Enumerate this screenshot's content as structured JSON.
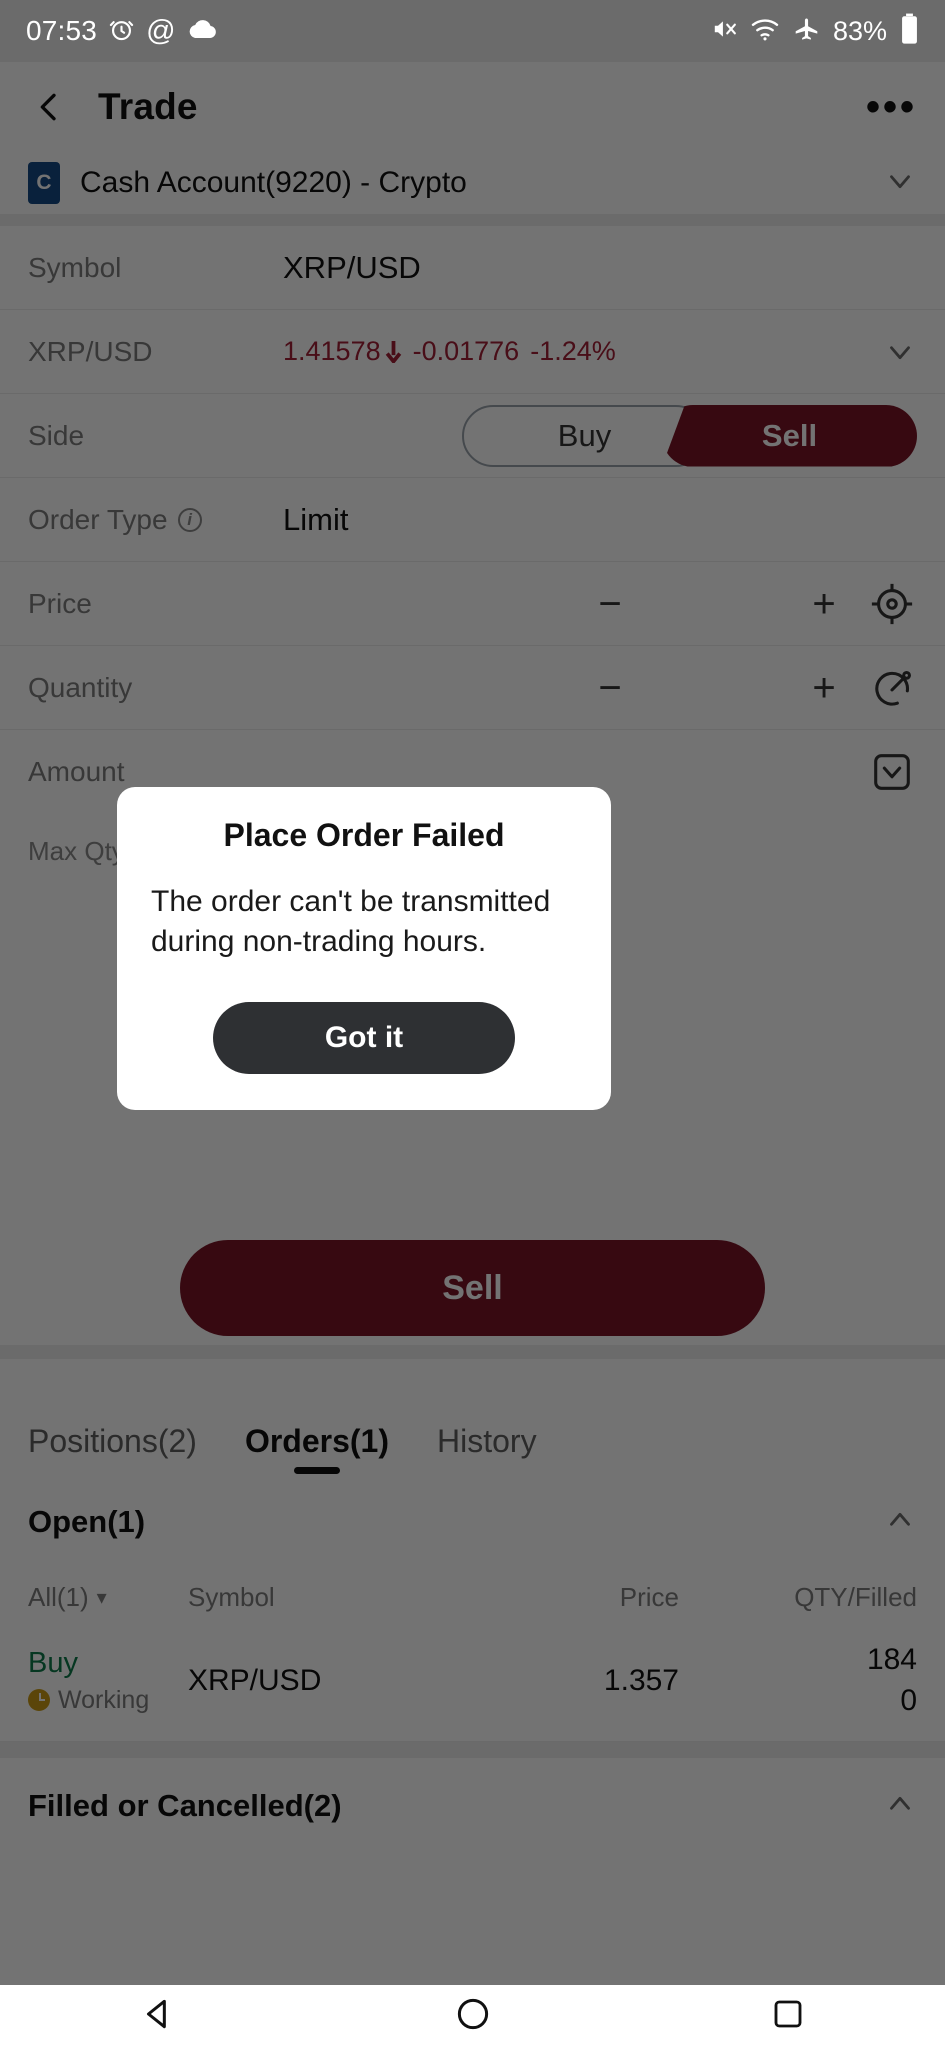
{
  "status_bar": {
    "time": "07:53",
    "battery_percent": "83%",
    "icons": [
      "alarm-icon",
      "at-sign-icon",
      "cloud-icon",
      "mute-icon",
      "wifi-icon",
      "airplane-mode-icon",
      "battery-icon"
    ]
  },
  "header": {
    "title": "Trade",
    "back_icon": "chevron-left-icon",
    "more_icon": "more-options-icon"
  },
  "account": {
    "badge": "C",
    "name": "Cash Account(9220) - Crypto",
    "chevron": "chevron-down-icon"
  },
  "form": {
    "symbol_label": "Symbol",
    "symbol_value": "XRP/USD",
    "quote_label": "XRP/USD",
    "quote_price": "1.41578",
    "quote_arrow": "▼",
    "quote_change": "-0.01776",
    "quote_percent": "-1.24%",
    "side_label": "Side",
    "side_buy": "Buy",
    "side_sell": "Sell",
    "side_selected": "Sell",
    "order_type_label": "Order Type",
    "order_type_value": "Limit",
    "price_label": "Price",
    "price_value": "",
    "quantity_label": "Quantity",
    "quantity_value": "",
    "amount_label": "Amount",
    "amount_value": "",
    "minus": "−",
    "plus": "+",
    "max_qty_text": "Max Qty to",
    "price_trail_icon": "crosshair-target-icon",
    "quantity_trail_icon": "speedometer-gauge-icon",
    "amount_trail_icon": "collapse-box-icon",
    "submit_label": "Sell"
  },
  "dialog": {
    "title": "Place Order Failed",
    "message": "The order can't be transmitted during non-trading hours.",
    "button_label": "Got it"
  },
  "bottom": {
    "tabs": [
      {
        "label": "Positions(2)",
        "active": false
      },
      {
        "label": "Orders(1)",
        "active": true
      },
      {
        "label": "History",
        "active": false
      }
    ],
    "open_section": {
      "title": "Open(1)",
      "caret": "chevron-up-icon"
    },
    "table": {
      "headers": {
        "filter": "All(1)",
        "filter_caret": "▾",
        "symbol": "Symbol",
        "price": "Price",
        "qty_filled": "QTY/Filled"
      },
      "rows": [
        {
          "side": "Buy",
          "status": "Working",
          "status_icon": "clock-icon",
          "symbol": "XRP/USD",
          "price": "1.357",
          "qty": "184",
          "filled": "0"
        }
      ]
    },
    "filled_section": {
      "title": "Filled or Cancelled(2)",
      "caret": "chevron-up-icon"
    }
  },
  "nav_bar": {
    "back": "nav-back-triangle-icon",
    "home": "nav-home-circle-icon",
    "recents": "nav-recents-square-icon"
  },
  "colors": {
    "sell_red": "#7b1527",
    "quote_red": "#a32036",
    "buy_green": "#0e7a4b",
    "working_gold": "#c99a16",
    "account_blue": "#144b86",
    "dialog_button": "#2e3033"
  }
}
